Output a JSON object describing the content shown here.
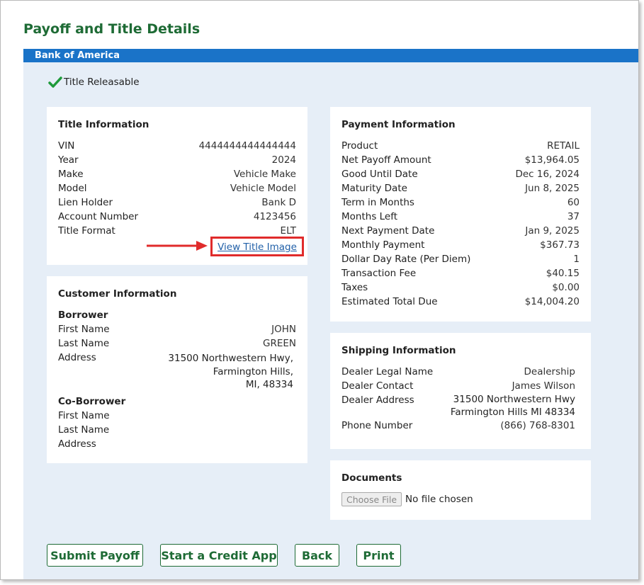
{
  "page": {
    "title": "Payoff and Title Details",
    "lender": "Bank of America",
    "status": "Title Releasable",
    "status_icon": "checkmark-icon",
    "accent_color": "#1e6b35",
    "bar_color": "#1a73c8",
    "link_color": "#2160a8",
    "highlight_color": "#e02b2b"
  },
  "title_info": {
    "heading": "Title Information",
    "rows": [
      {
        "label": "VIN",
        "value": "4444444444444444"
      },
      {
        "label": "Year",
        "value": "2024"
      },
      {
        "label": "Make",
        "value": "Vehicle Make"
      },
      {
        "label": "Model",
        "value": "Vehicle Model"
      },
      {
        "label": "Lien Holder",
        "value": "Bank D"
      },
      {
        "label": "Account Number",
        "value": "4123456"
      },
      {
        "label": "Title Format",
        "value": "ELT"
      }
    ],
    "link": "View Title Image"
  },
  "customer_info": {
    "heading": "Customer Information",
    "borrower": {
      "heading": "Borrower",
      "first_name_label": "First Name",
      "first_name": "JOHN",
      "last_name_label": "Last Name",
      "last_name": "GREEN",
      "address_label": "Address",
      "address_lines": [
        "31500 Northwestern Hwy,",
        "Farmington Hills,",
        "MI, 48334"
      ]
    },
    "co_borrower": {
      "heading": "Co-Borrower",
      "first_name_label": "First Name",
      "last_name_label": "Last Name",
      "address_label": "Address"
    }
  },
  "payment_info": {
    "heading": "Payment Information",
    "rows": [
      {
        "label": "Product",
        "value": "RETAIL"
      },
      {
        "label": "Net Payoff Amount",
        "value": "$13,964.05"
      },
      {
        "label": "Good Until Date",
        "value": "Dec 16, 2024"
      },
      {
        "label": "Maturity Date",
        "value": "Jun 8, 2025"
      },
      {
        "label": "Term in Months",
        "value": "60"
      },
      {
        "label": "Months Left",
        "value": "37"
      },
      {
        "label": "Next Payment Date",
        "value": "Jan 9, 2025"
      },
      {
        "label": "Monthly Payment",
        "value": "$367.73"
      },
      {
        "label": "Dollar Day Rate (Per Diem)",
        "value": "1"
      },
      {
        "label": "Transaction Fee",
        "value": "$40.15"
      },
      {
        "label": "Taxes",
        "value": "$0.00"
      },
      {
        "label": "Estimated Total Due",
        "value": "$14,004.20"
      }
    ]
  },
  "shipping_info": {
    "heading": "Shipping Information",
    "legal_name_label": "Dealer Legal Name",
    "legal_name": "Dealership",
    "contact_label": "Dealer Contact",
    "contact": "James Wilson",
    "address_label": "Dealer Address",
    "address_lines": [
      "31500 Northwestern Hwy",
      "Farmington Hills MI 48334"
    ],
    "phone_label": "Phone Number",
    "phone": "(866) 768-8301"
  },
  "documents": {
    "heading": "Documents",
    "choose_file": "Choose File",
    "no_file": "No file chosen"
  },
  "actions": {
    "submit": "Submit Payoff",
    "credit_app": "Start a Credit App",
    "back": "Back",
    "print": "Print"
  }
}
